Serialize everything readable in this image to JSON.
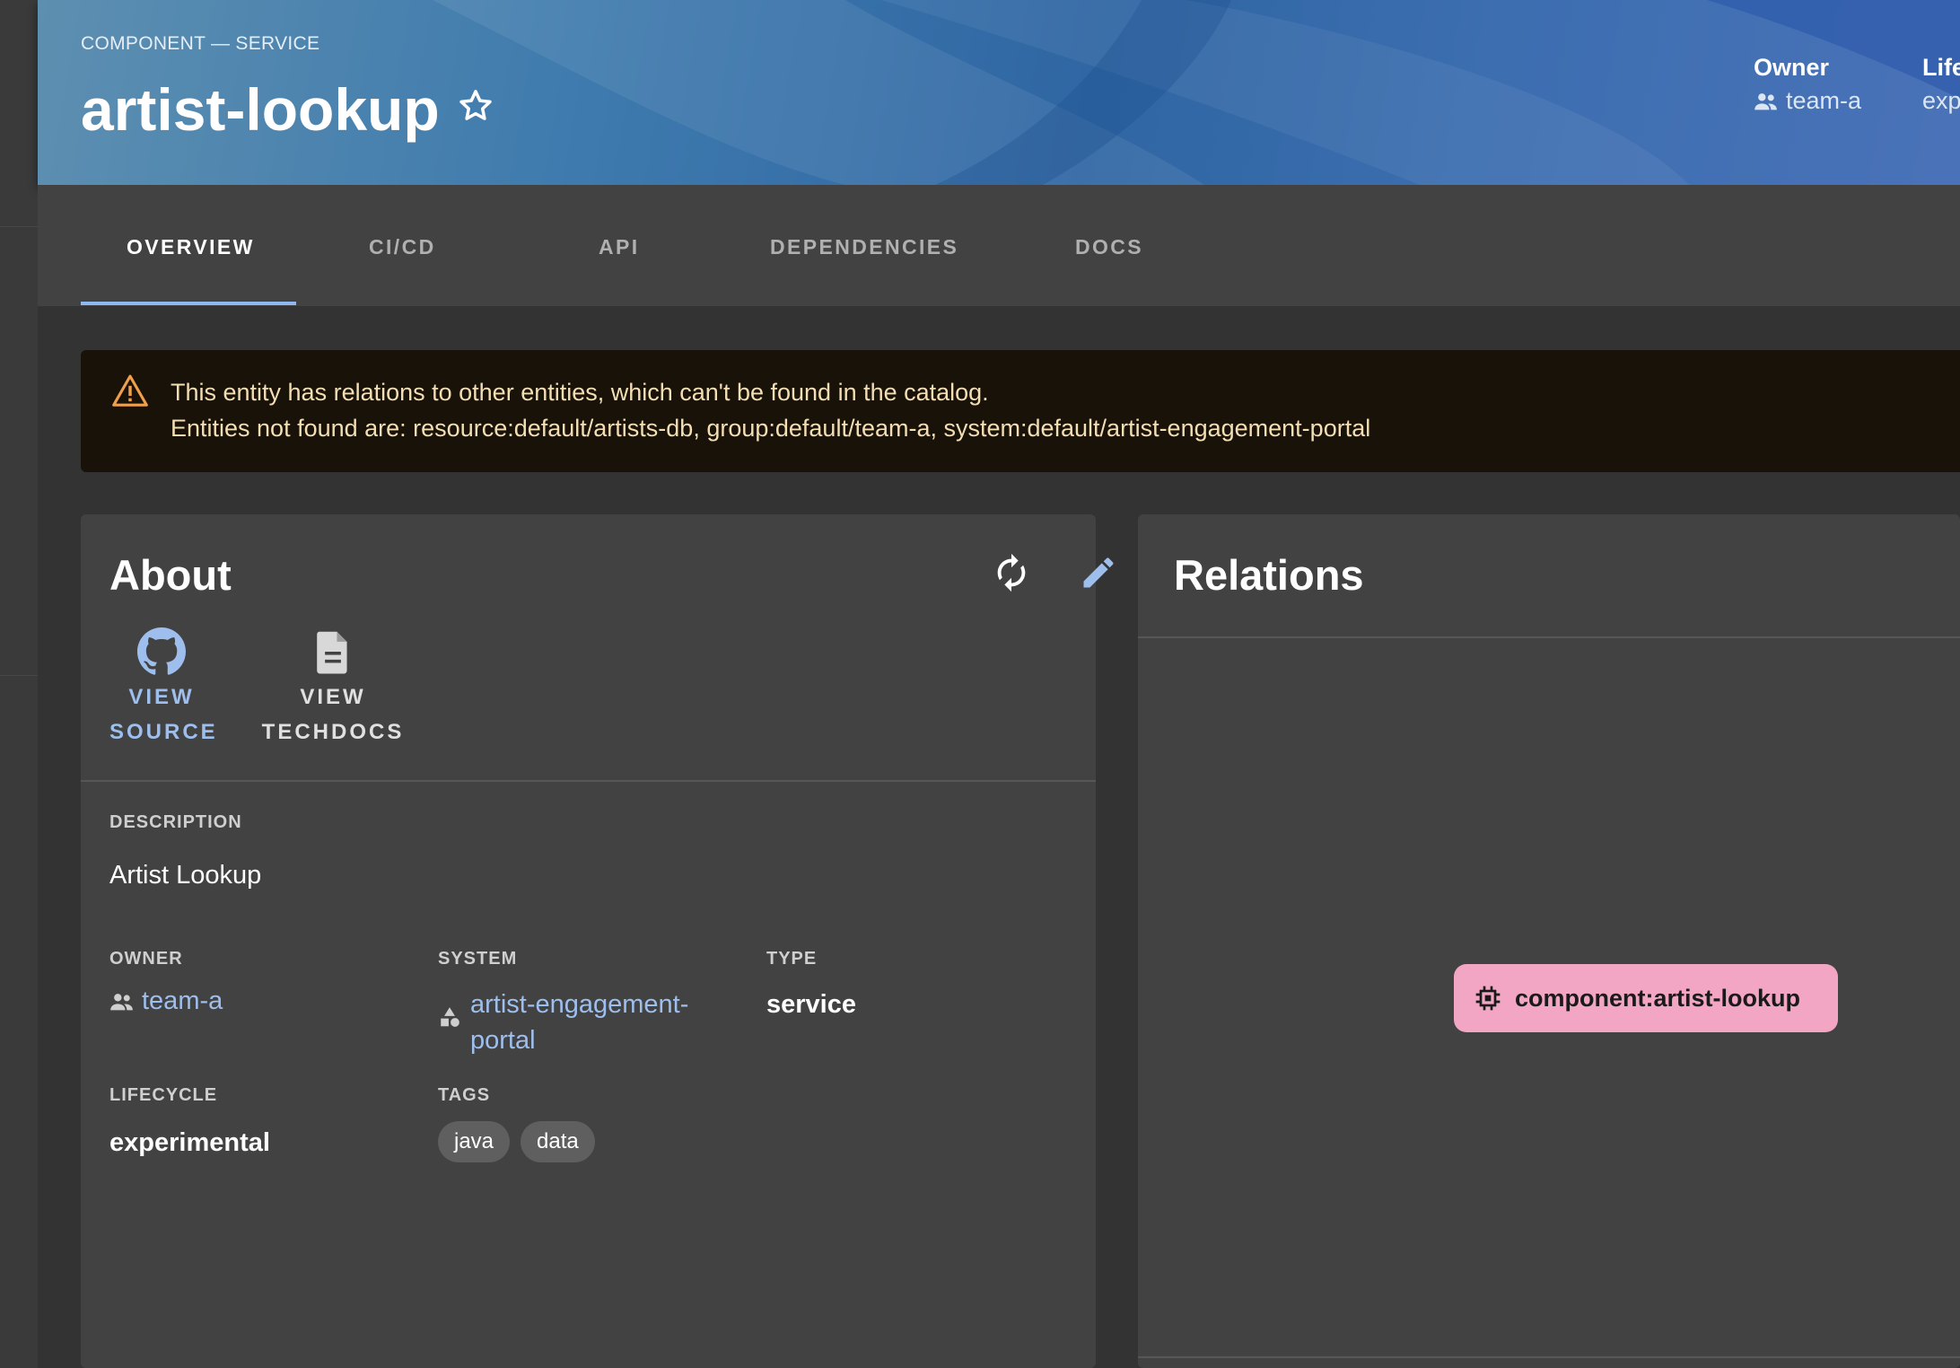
{
  "header": {
    "breadcrumb": "COMPONENT — SERVICE",
    "title": "artist-lookup",
    "owner_label": "Owner",
    "owner_value": "team-a",
    "lifecycle_label": "Life",
    "lifecycle_value": "exp"
  },
  "tabs": [
    {
      "label": "OVERVIEW",
      "active": true
    },
    {
      "label": "CI/CD",
      "active": false
    },
    {
      "label": "API",
      "active": false
    },
    {
      "label": "DEPENDENCIES",
      "active": false
    },
    {
      "label": "DOCS",
      "active": false
    }
  ],
  "warning": {
    "line1": "This entity has relations to other entities, which can't be found in the catalog.",
    "line2": "Entities not found are: resource:default/artists-db, group:default/team-a, system:default/artist-engagement-portal"
  },
  "about": {
    "title": "About",
    "view_source_line1": "VIEW",
    "view_source_line2": "SOURCE",
    "view_techdocs_line1": "VIEW",
    "view_techdocs_line2": "TECHDOCS",
    "description_label": "DESCRIPTION",
    "description": "Artist Lookup",
    "owner_label": "OWNER",
    "owner": "team-a",
    "system_label": "SYSTEM",
    "system_line1": "artist-engagement-",
    "system_line2": "portal",
    "type_label": "TYPE",
    "type": "service",
    "lifecycle_label": "LIFECYCLE",
    "lifecycle": "experimental",
    "tags_label": "TAGS",
    "tags": [
      "java",
      "data"
    ]
  },
  "relations": {
    "title": "Relations",
    "node_label": "component:artist-lookup"
  },
  "colors": {
    "accent": "#9ebfee",
    "warning_text": "#f4dfb4",
    "warning_icon": "#f0a04b",
    "node_bg": "#f2a6c4"
  }
}
